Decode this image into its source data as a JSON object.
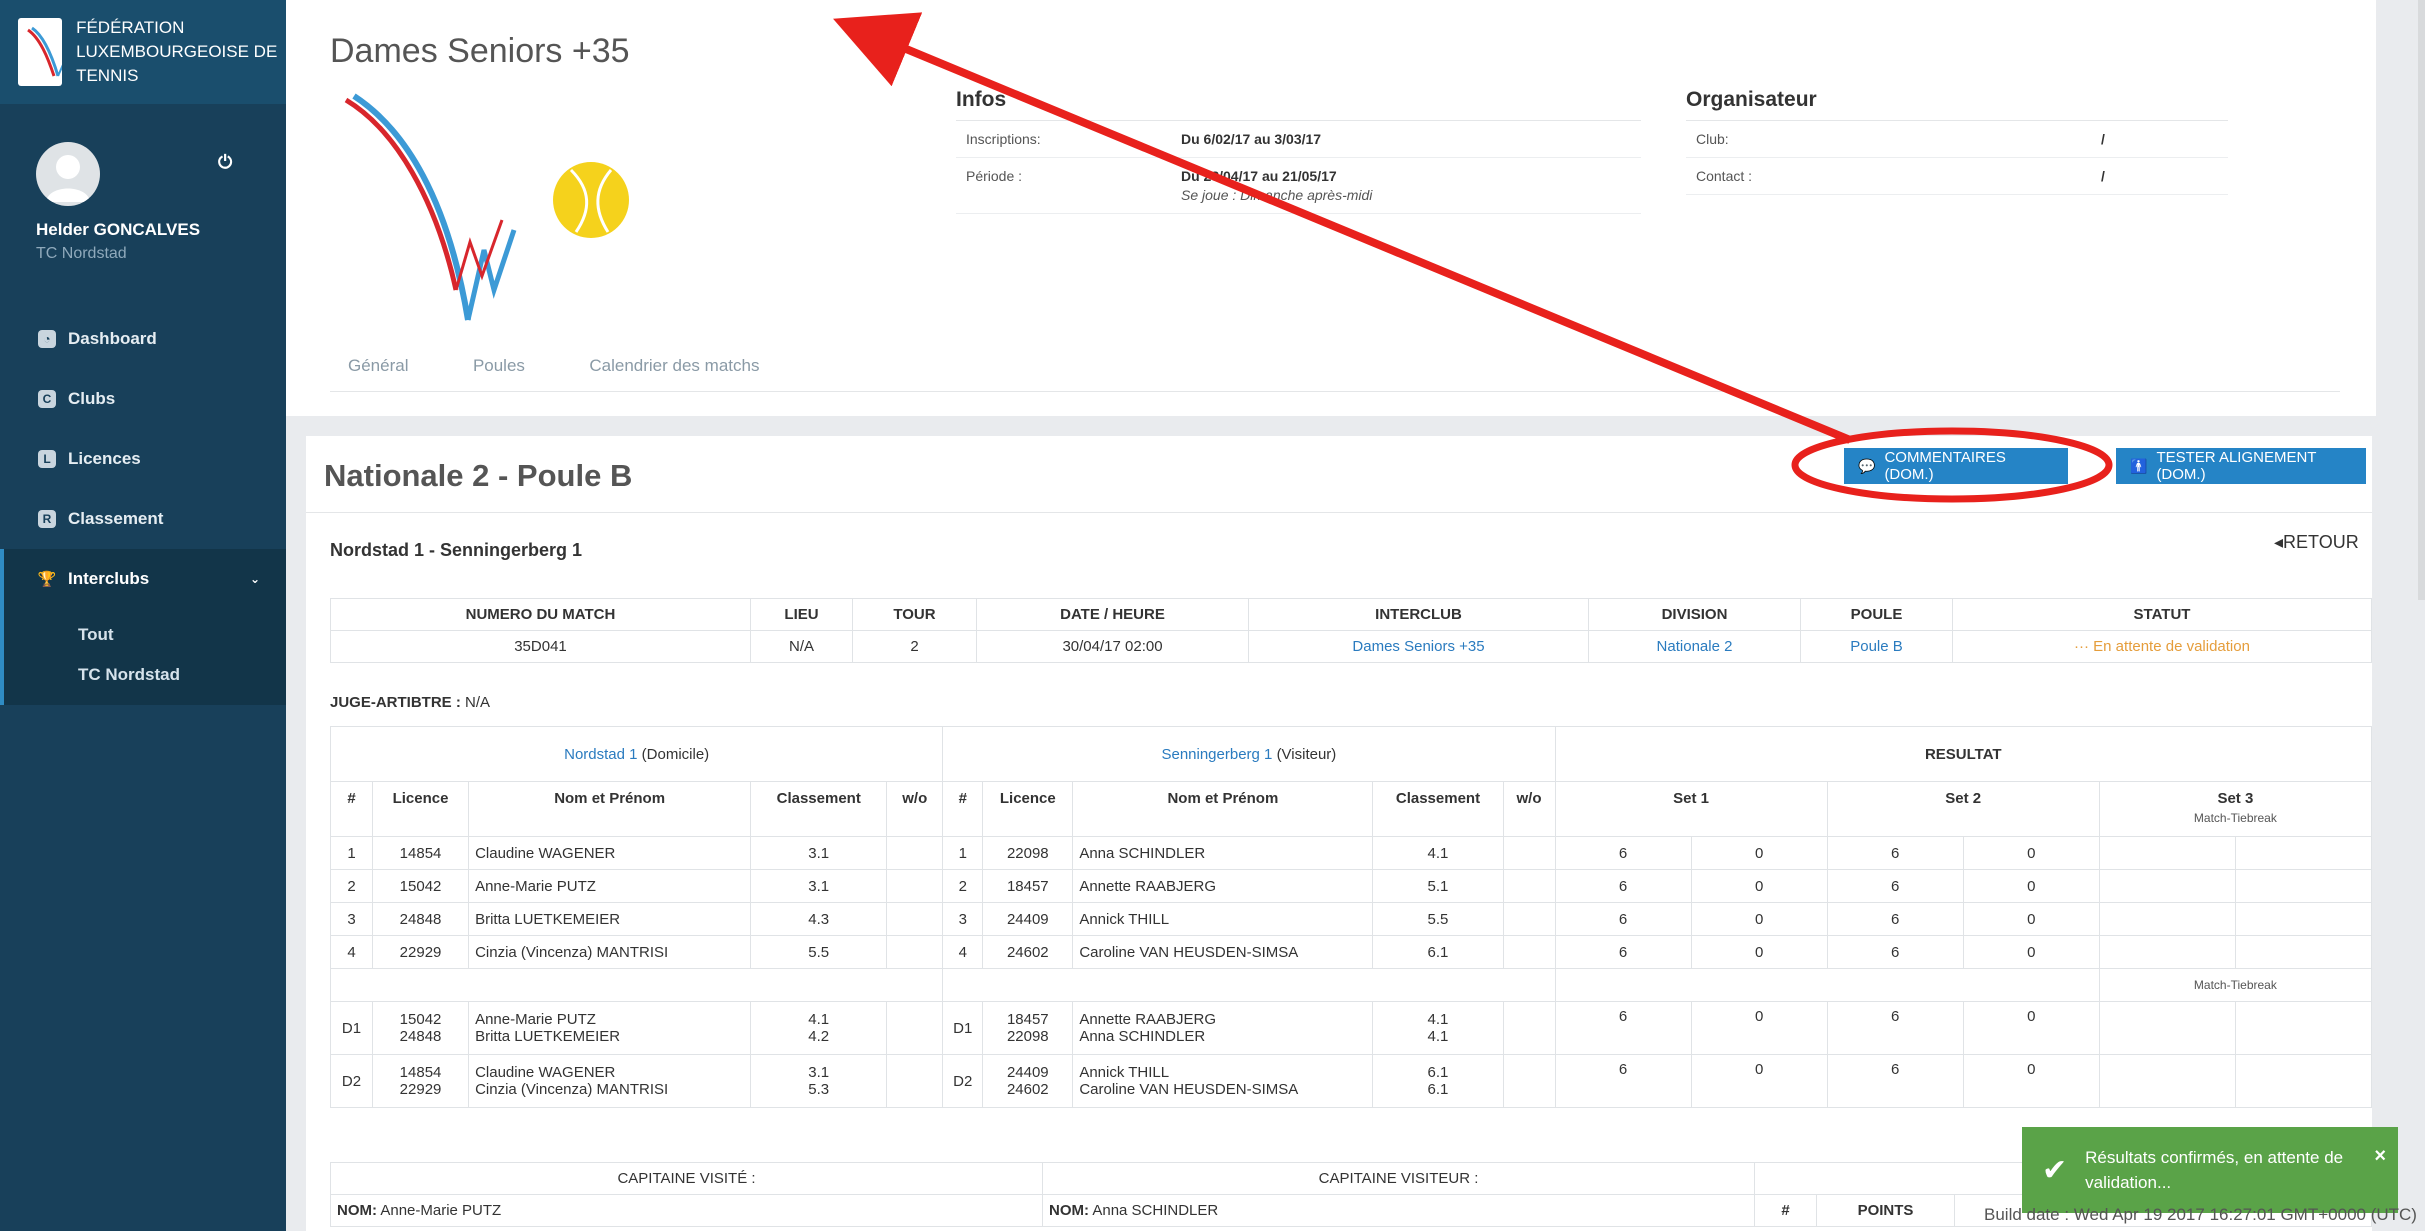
{
  "sidebar": {
    "brand": "FÉDÉRATION LUXEMBOURGEOISE DE TENNIS",
    "user_name": "Helder GONCALVES",
    "user_club": "TC Nordstad",
    "nav": [
      {
        "label": "Dashboard",
        "icon": "dashboard-icon",
        "glyph": "◔"
      },
      {
        "label": "Clubs",
        "icon": "clubs-icon",
        "glyph": "C"
      },
      {
        "label": "Licences",
        "icon": "licences-icon",
        "glyph": "L"
      },
      {
        "label": "Classement",
        "icon": "classement-icon",
        "glyph": "R"
      },
      {
        "label": "Interclubs",
        "icon": "trophy-icon",
        "glyph": "🏆"
      }
    ],
    "subnav": [
      "Tout",
      "TC Nordstad"
    ]
  },
  "header": {
    "title": "Dames Seniors +35",
    "tabs": [
      "Général",
      "Poules",
      "Calendrier des matchs"
    ],
    "infos": {
      "heading": "Infos",
      "inscriptions_label": "Inscriptions:",
      "inscriptions_value": "Du 6/02/17 au 3/03/17",
      "periode_label": "Période :",
      "periode_value": "Du 23/04/17 au 21/05/17",
      "periode_note": "Se joue : Dimanche après-midi"
    },
    "organisateur": {
      "heading": "Organisateur",
      "club_label": "Club:",
      "club_value": "/",
      "contact_label": "Contact :",
      "contact_value": "/"
    }
  },
  "match": {
    "poule_title": "Nationale 2 - Poule B",
    "btn_comments": "COMMENTAIRES (DOM.)",
    "btn_tester": "TESTER ALIGNEMENT (DOM.)",
    "name": "Nordstad 1 - Senningerberg 1",
    "retour": "RETOUR",
    "info_headers": [
      "NUMERO DU MATCH",
      "LIEU",
      "TOUR",
      "DATE / HEURE",
      "INTERCLUB",
      "DIVISION",
      "POULE",
      "STATUT"
    ],
    "info_values": {
      "numero": "35D041",
      "lieu": "N/A",
      "tour": "2",
      "date": "30/04/17 02:00",
      "interclub": "Dames Seniors +35",
      "division": "Nationale 2",
      "poule": "Poule B",
      "statut": "En attente de validation"
    },
    "juge_label": "JUGE-ARTIBTRE :",
    "juge_value": "N/A",
    "home_team": "Nordstad 1",
    "home_suffix": "(Domicile)",
    "away_team": "Senningerberg 1",
    "away_suffix": "(Visiteur)",
    "resultat": "RESULTAT",
    "col_headers": {
      "num": "#",
      "licence": "Licence",
      "nom": "Nom et Prénom",
      "classement": "Classement",
      "wo": "w/o",
      "set1": "Set 1",
      "set2": "Set 2",
      "set3": "Set 3",
      "tiebreak": "Match-Tiebreak"
    },
    "singles": [
      {
        "n": "1",
        "hl": "14854",
        "hn": "Claudine WAGENER",
        "hc": "3.1",
        "al": "22098",
        "an": "Anna SCHINDLER",
        "ac": "4.1",
        "s": [
          "6",
          "0",
          "6",
          "0"
        ]
      },
      {
        "n": "2",
        "hl": "15042",
        "hn": "Anne-Marie PUTZ",
        "hc": "3.1",
        "al": "18457",
        "an": "Annette RAABJERG",
        "ac": "5.1",
        "s": [
          "6",
          "0",
          "6",
          "0"
        ]
      },
      {
        "n": "3",
        "hl": "24848",
        "hn": "Britta LUETKEMEIER",
        "hc": "4.3",
        "al": "24409",
        "an": "Annick THILL",
        "ac": "5.5",
        "s": [
          "6",
          "0",
          "6",
          "0"
        ]
      },
      {
        "n": "4",
        "hl": "22929",
        "hn": "Cinzia (Vincenza) MANTRISI",
        "hc": "5.5",
        "al": "24602",
        "an": "Caroline VAN HEUSDEN-SIMSA",
        "ac": "6.1",
        "s": [
          "6",
          "0",
          "6",
          "0"
        ]
      }
    ],
    "doubles": [
      {
        "n": "D1",
        "hl1": "15042",
        "hl2": "24848",
        "hn1": "Anne-Marie PUTZ",
        "hn2": "Britta LUETKEMEIER",
        "hc1": "4.1",
        "hc2": "4.2",
        "al1": "18457",
        "al2": "22098",
        "an1": "Annette RAABJERG",
        "an2": "Anna SCHINDLER",
        "ac1": "4.1",
        "ac2": "4.1",
        "s": [
          "6",
          "0",
          "6",
          "0"
        ]
      },
      {
        "n": "D2",
        "hl1": "14854",
        "hl2": "22929",
        "hn1": "Claudine WAGENER",
        "hn2": "Cinzia (Vincenza) MANTRISI",
        "hc1": "3.1",
        "hc2": "5.3",
        "al1": "24409",
        "al2": "24602",
        "an1": "Annick THILL",
        "an2": "Caroline VAN HEUSDEN-SIMSA",
        "ac1": "6.1",
        "ac2": "6.1",
        "s": [
          "6",
          "0",
          "6",
          "0"
        ]
      }
    ],
    "capitaine_visite": "CAPITAINE VISITÉ :",
    "capitaine_visiteur": "CAPITAINE VISITEUR :",
    "resultat_partial": "RESULTAT",
    "nom_label": "NOM:",
    "home_captain": "Anne-Marie PUTZ",
    "away_captain": "Anna SCHINDLER",
    "points_hash": "#",
    "points": "POINTS"
  },
  "toast": {
    "text": "Résultats confirmés, en attente de validation...",
    "close": "×"
  },
  "build": "Build date : Wed Apr 19 2017 16:27:01 GMT+0000 (UTC)",
  "colors": {
    "sidebar": "#18405a",
    "accent": "#2584c6",
    "link": "#2a7bbf",
    "pending": "#e59d3b",
    "toast": "#5aa348",
    "annotation": "#e8211c"
  }
}
